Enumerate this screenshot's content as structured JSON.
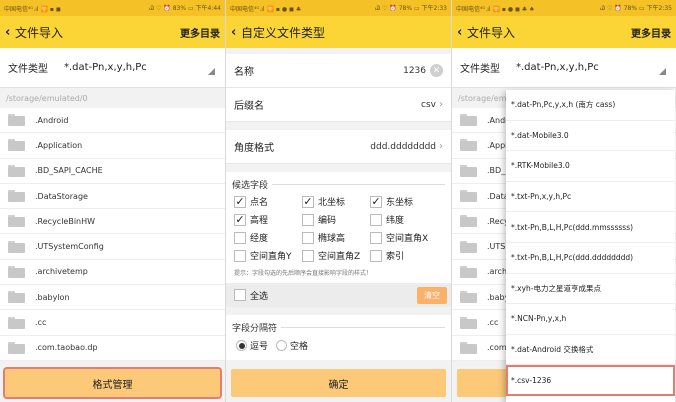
{
  "status_bars": [
    {
      "left": "中国电信⁴ᴳ.ıl 🛜 ▪ ◼",
      "right": "Ꮚ ♡ ⏰ 83% ▭ 下午4:44"
    },
    {
      "left": "中国电信⁴ᴳ.ıl 🛜 ▪ ● ◼ ♣",
      "right": "Ꮚ ♡ ⏰ 78% ▭ 下午2:33"
    },
    {
      "left": "中国电信⁴ᴳ.ıl 🛜 ▪ ● ◼ ♣ ♠",
      "right": "Ꮚ ♡ ⏰ 78% ▭ 下午2:35"
    }
  ],
  "panel1": {
    "title": "文件导入",
    "more": "更多目录",
    "file_type_label": "文件类型",
    "file_type_value": "*.dat-Pn,x,y,h,Pc",
    "path": "/storage/emulated/0",
    "folders": [
      ".Android",
      ".Application",
      ".BD_SAPI_CACHE",
      ".DataStorage",
      ".RecycleBinHW",
      ".UTSystemConfig",
      ".archivetemp",
      ".babylon",
      ".cc",
      ".com.taobao.dp"
    ],
    "bottom_button": "格式管理"
  },
  "panel2": {
    "title": "自定义文件类型",
    "name_label": "名称",
    "name_value": "1236",
    "suffix_label": "后缀名",
    "suffix_value": "csv",
    "angle_label": "角度格式",
    "angle_value": "ddd.dddddddd",
    "fields_title": "候选字段",
    "fields": [
      {
        "label": "点名",
        "checked": true
      },
      {
        "label": "北坐标",
        "checked": true
      },
      {
        "label": "东坐标",
        "checked": true
      },
      {
        "label": "高程",
        "checked": true
      },
      {
        "label": "编码",
        "checked": false
      },
      {
        "label": "纬度",
        "checked": false
      },
      {
        "label": "经度",
        "checked": false
      },
      {
        "label": "椭球高",
        "checked": false
      },
      {
        "label": "空间直角X",
        "checked": false
      },
      {
        "label": "空间直角Y",
        "checked": false
      },
      {
        "label": "空间直角Z",
        "checked": false
      },
      {
        "label": "索引",
        "checked": false
      }
    ],
    "hint": "提示：字段勾选的先后顺序会直接影响字段的样式！",
    "select_all": "全选",
    "clear": "清空",
    "sep_title": "字段分隔符",
    "sep_options": [
      {
        "label": "逗号",
        "selected": true
      },
      {
        "label": "空格",
        "selected": false
      }
    ],
    "confirm": "确定"
  },
  "panel3": {
    "title": "文件导入",
    "more": "更多目录",
    "file_type_label": "文件类型",
    "file_type_value": "*.dat-Pn,x,y,h,Pc",
    "path": "/storage/em",
    "folders": [
      ".Andr",
      ".Appl",
      ".BD_",
      ".Data",
      ".Recy",
      ".UTS",
      ".arch",
      ".baby",
      ".cc",
      ".com"
    ],
    "options": [
      "*.dat-Pn,Pc,y,x,h (南方 cass)",
      "*.dat-Mobile3.0",
      "*.RTK-Mobile3.0",
      "*.txt-Pn,x,y,h,Pc",
      "*.txt-Pn,B,L,H,Pc(ddd.mmssssss)",
      "*.txt-Pn,B,L,H,Pc(ddd.dddddddd)",
      "*.xyh-电力之星道亨成果点",
      "*.NCN-Pn,y,x,h",
      "*.dat-Android 交换格式",
      "*.csv-1236"
    ],
    "selected_option_index": 9
  }
}
